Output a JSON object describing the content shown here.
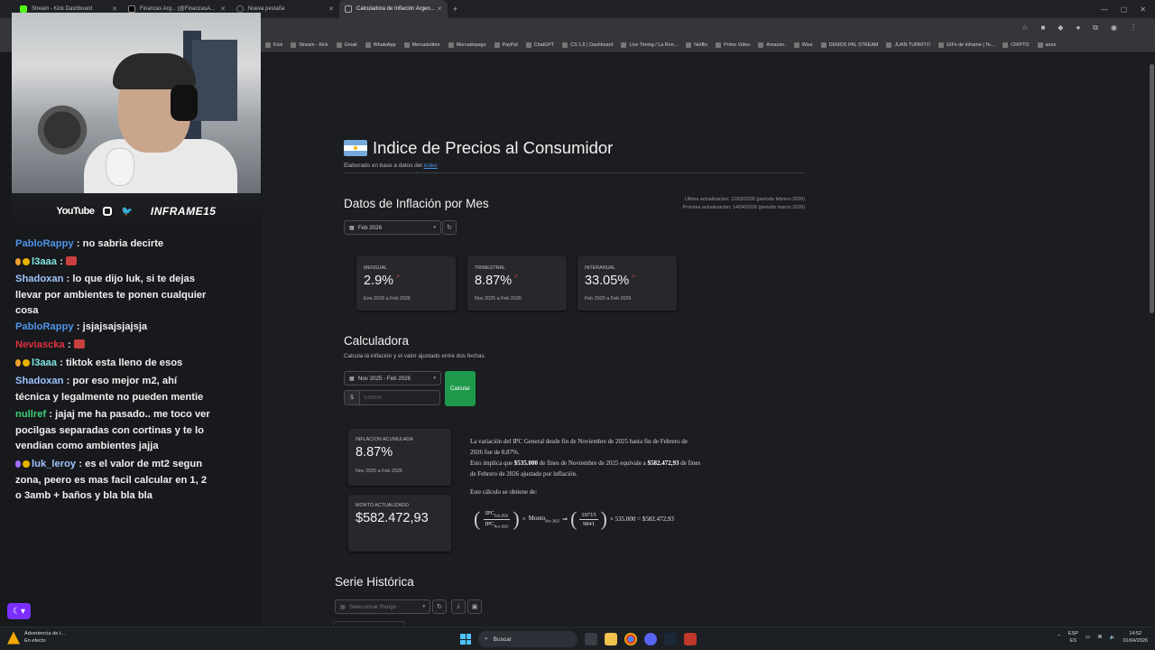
{
  "browser": {
    "tabs": [
      {
        "label": "Stream - Kick Dashboard",
        "active": false
      },
      {
        "label": "Finanzas Arg... (@FinanzasA...",
        "active": false
      },
      {
        "label": "Nueva pestaña",
        "active": false
      },
      {
        "label": "Calculadora de Inflación Argen...",
        "active": true
      }
    ],
    "bookmarks": [
      "Kick",
      "Stream - Kick",
      "Gmail",
      "WhatsApp",
      "Mercadolibre",
      "Mercadopago",
      "PayPal",
      "ChatGPT",
      "CS 1.6 | Dashboard",
      "Live Timing / La Ron...",
      "Netflix",
      "Prime Video",
      "Amazon.",
      "Wise",
      "DEMOS PAL STREAM",
      "JUAN TURRITO",
      "GIFs de Inframe | Te...",
      "CRIPTO",
      "aires"
    ]
  },
  "stream": {
    "social_youtube": "YouTube",
    "handle": "INFRAME15"
  },
  "chat": [
    {
      "user": "PabloRappy",
      "color": "#4f93e8",
      "text": "no sabria decirte",
      "badges": []
    },
    {
      "user": "l3aaa",
      "color": "#7fe3e0",
      "text": "",
      "badges": [
        "hand",
        "coin"
      ],
      "emote": true
    },
    {
      "user": "Shadoxan",
      "color": "#9fc3ff",
      "text": "lo que dijo luk, si te dejas llevar por ambientes te ponen cualquier cosa",
      "badges": []
    },
    {
      "user": "PabloRappy",
      "color": "#4f93e8",
      "text": "jsjajsajsjajsja",
      "badges": []
    },
    {
      "user": "Neviascka",
      "color": "#e0303f",
      "text": "",
      "badges": [],
      "emote": true
    },
    {
      "user": "l3aaa",
      "color": "#7fe3e0",
      "text": "tiktok esta lleno de esos",
      "badges": [
        "hand",
        "coin"
      ]
    },
    {
      "user": "Shadoxan",
      "color": "#9fc3ff",
      "text": "por eso mejor m2, ahí técnica y legalmente no pueden mentie",
      "badges": []
    },
    {
      "user": "nullref",
      "color": "#3fd17a",
      "text": "jajaj me ha pasado.. me toco ver pocilgas separadas con cortinas y te lo vendian como ambientes jajja",
      "badges": []
    },
    {
      "user": "luk_leroy",
      "color": "#9fc3ff",
      "text": "es el valor de mt2 segun zona, peero es mas facil calcular en 1, 2 o 3amb + baños y bla bla bla",
      "badges": [
        "purple",
        "coin"
      ]
    }
  ],
  "page": {
    "title": "Indice de Precios al Consumidor",
    "source_prefix": "Elaborado en base a datos del ",
    "source_link": "indec",
    "monthly": {
      "heading": "Datos de Inflación por Mes",
      "last_update": "Ultima actualizacion: 12/03/2026 (periodo febrero 2026)",
      "next_update": "Próxima actualizacion: 14/04/2026 (periodo marzo 2026)",
      "month_select": "Feb 2026",
      "cards": [
        {
          "label": "MENSUAL",
          "value": "2.9%",
          "period": "Ene 2026 a Feb 2026"
        },
        {
          "label": "TRIMESTRAL",
          "value": "8.87%",
          "period": "Nov 2025 a Feb 2026"
        },
        {
          "label": "INTERANUAL",
          "value": "33.05%",
          "period": "Feb 2025 a Feb 2026"
        }
      ]
    },
    "calculator": {
      "heading": "Calculadora",
      "subtitle": "Calcula la inflación y el valor ajustado entre dos fechas.",
      "range_select": "Nov 2025 - Feb 2026",
      "currency": "$",
      "amount_placeholder": "535000",
      "button": "Calcular",
      "accum_label": "INFLACION ACUMULADA",
      "accum_value": "8.87%",
      "accum_period": "Nov 2025 a Feb 2026",
      "adjusted_label": "MONTO ACTUALIZADO",
      "adjusted_value": "$582.472,93",
      "result_line1": "La variación del IPC General desde fin de Noviembre de 2025 hasta fin de Febrero de 2026 fue de 8.87%.",
      "result_line2_a": "Esto implica que ",
      "result_line2_amount": "$535.000",
      "result_line2_b": " de fines de Noviembre de 2025 equivale a ",
      "result_line2_adjusted": "$582.472,93",
      "result_line2_c": " de fines de Febrero de 2026 ajustado por inflación.",
      "formula_intro": "Este cálculo se obtiene de:",
      "formula": {
        "num": "IPC",
        "num_sub": "Feb 2026",
        "den": "IPC",
        "den_sub": "Nov 2025",
        "times": "×",
        "monto": "Monto",
        "monto_sub": "Nov 2025",
        "arrow": "⇒",
        "val_num": "10715",
        "val_den": "9841",
        "result": "× 535.000 = $582.472,93"
      }
    },
    "history": {
      "heading": "Serie Histórica",
      "range_placeholder": "Seleccionar Rango"
    }
  },
  "taskbar": {
    "notif_title": "Advertencia de t...",
    "notif_sub": "En efecto",
    "search": "Buscar",
    "lang1": "ESP",
    "lang2": "ES",
    "time": "14:52",
    "date": "01/04/2026"
  }
}
